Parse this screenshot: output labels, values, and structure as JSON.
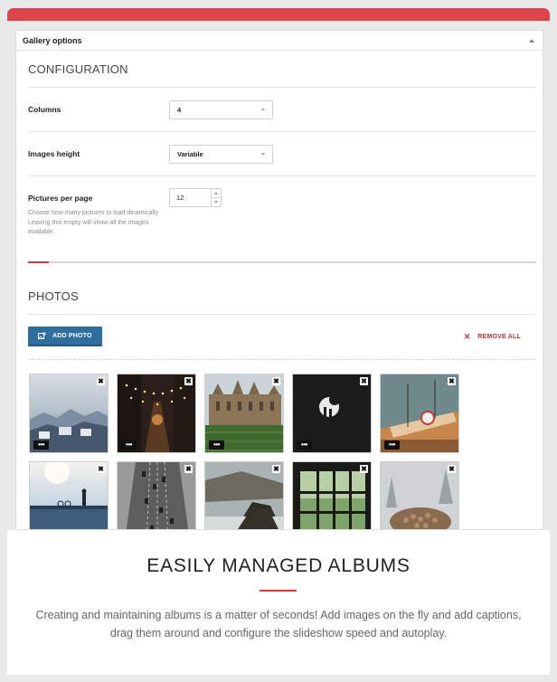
{
  "panel": {
    "title": "Gallery options",
    "configuration": {
      "heading": "CONFIGURATION",
      "columns": {
        "label": "Columns",
        "value": "4"
      },
      "images_height": {
        "label": "Images height",
        "value": "Variable"
      },
      "pictures_per_page": {
        "label": "Pictures per page",
        "value": "12",
        "help": "Choose how many pictures to load dinamically. Leaving this empty will show all the images available."
      }
    },
    "photos": {
      "heading": "PHOTOS",
      "add_photo_label": "ADD PHOTO",
      "remove_all_label": "REMOVE ALL",
      "close_glyph": "✖",
      "more_glyph": "•••",
      "items": [
        {
          "name": "snowy-town-rooftops"
        },
        {
          "name": "night-street-lights"
        },
        {
          "name": "college-building-lawn"
        },
        {
          "name": "silhouettes-dark"
        },
        {
          "name": "boat-harbor"
        },
        {
          "name": "lakeside-silhouette"
        },
        {
          "name": "highway-aerial"
        },
        {
          "name": "rocky-seashore"
        },
        {
          "name": "window-forest"
        },
        {
          "name": "misty-woodpile"
        }
      ]
    }
  },
  "footer": {
    "headline": "EASILY MANAGED ALBUMS",
    "description": "Creating and maintaining albums is a matter of seconds! Add images on the fly and add captions, drag them around and configure the slideshow speed and autoplay."
  },
  "colors": {
    "accent_red": "#e0434a",
    "button_blue": "#2f6fa0"
  }
}
